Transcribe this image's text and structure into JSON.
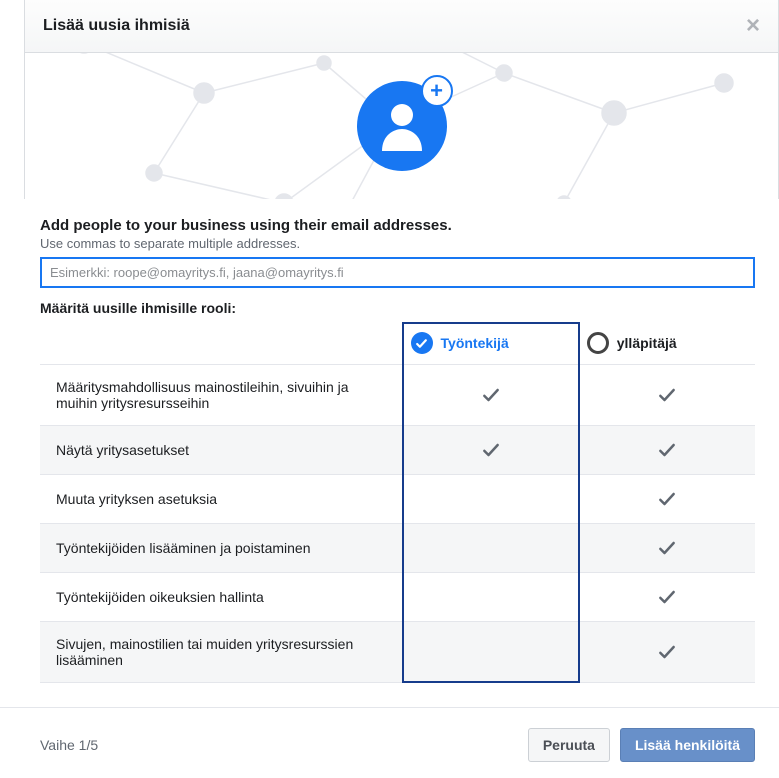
{
  "header": {
    "title": "Lisää uusia ihmisiä"
  },
  "lead": "Add people to your business using their email addresses.",
  "sub": "Use commas to separate multiple addresses.",
  "email_placeholder": "Esimerkki: roope@omayritys.fi, jaana@omayritys.fi",
  "role_label": "Määritä uusille ihmisille rooli:",
  "roles": {
    "employee": "Työntekijä",
    "admin": "ylläpitäjä"
  },
  "rows": [
    {
      "label": "Määritysmahdollisuus mainostileihin, sivuihin ja muihin yritysresursseihin",
      "emp": true,
      "adm": true
    },
    {
      "label": "Näytä yritysasetukset",
      "emp": true,
      "adm": true
    },
    {
      "label": "Muuta yrityksen asetuksia",
      "emp": false,
      "adm": true
    },
    {
      "label": "Työntekijöiden lisääminen ja poistaminen",
      "emp": false,
      "adm": true
    },
    {
      "label": "Työntekijöiden oikeuksien hallinta",
      "emp": false,
      "adm": true
    },
    {
      "label": "Sivujen, mainostilien tai muiden yritysresurssien lisääminen",
      "emp": false,
      "adm": true
    }
  ],
  "footer": {
    "step": "Vaihe 1/5",
    "cancel": "Peruuta",
    "submit": "Lisää henkilöitä"
  }
}
